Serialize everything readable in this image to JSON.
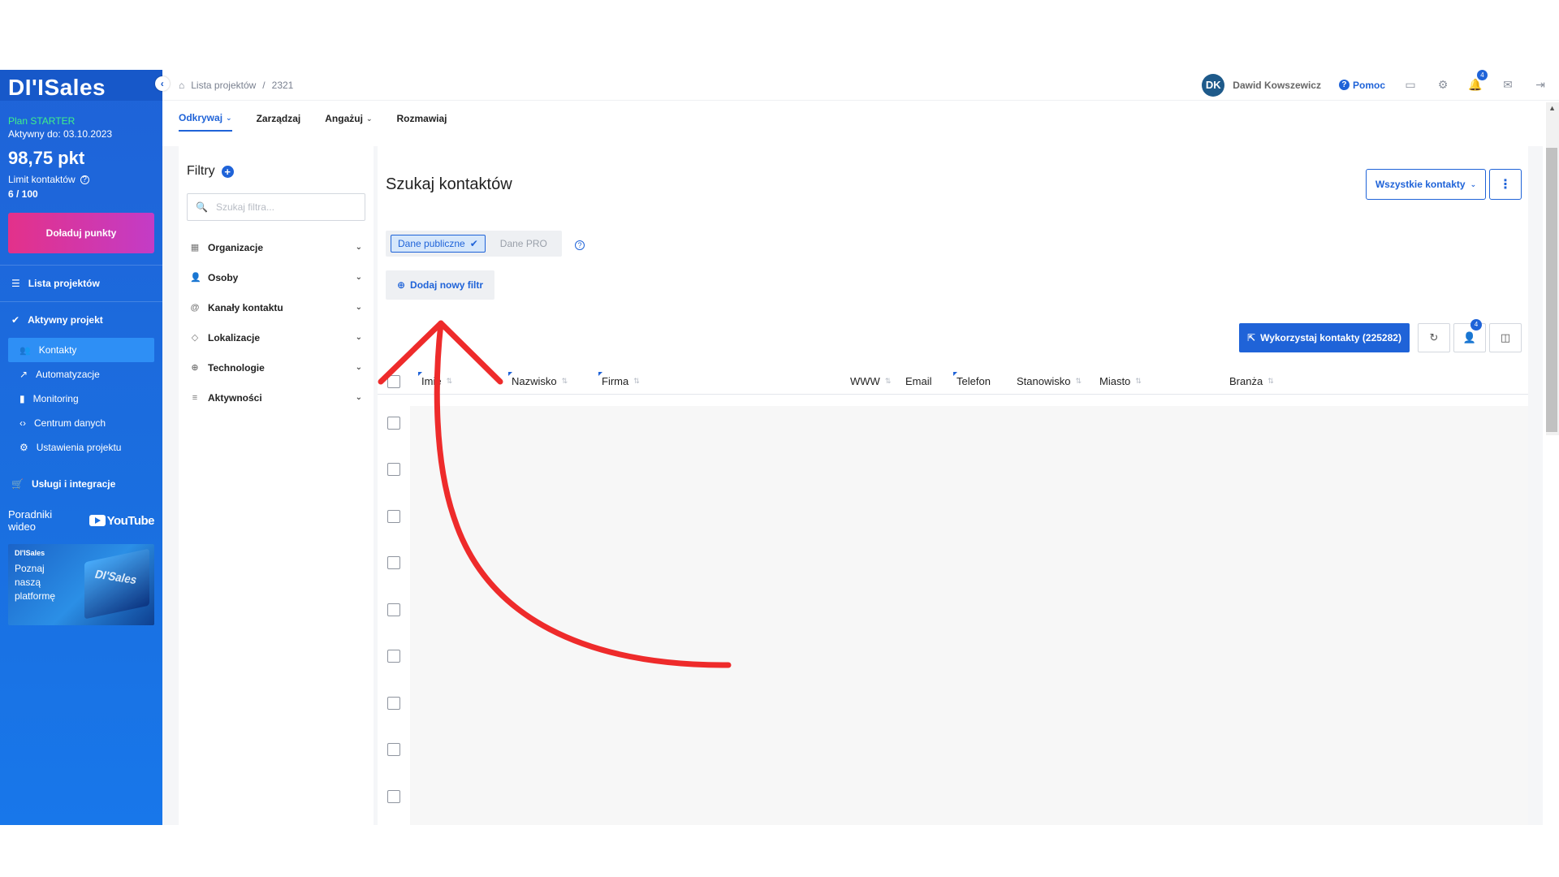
{
  "brand": {
    "logo": "DI'ISales"
  },
  "plan": {
    "name": "Plan STARTER",
    "active_until": "Aktywny do: 03.10.2023",
    "points": "98,75 pkt",
    "limit_label": "Limit kontaktów",
    "limit_value": "6 / 100",
    "topup_button": "Doładuj punkty"
  },
  "sidebar": {
    "projects": "Lista projektów",
    "active_project": "Aktywny projekt",
    "sub_items": [
      {
        "label": "Kontakty",
        "icon": "users-icon",
        "active": true
      },
      {
        "label": "Automatyzacje",
        "icon": "trend-icon",
        "active": false
      },
      {
        "label": "Monitoring",
        "icon": "bar-chart-icon",
        "active": false
      },
      {
        "label": "Centrum danych",
        "icon": "code-icon",
        "active": false
      },
      {
        "label": "Ustawienia projektu",
        "icon": "gear-icon",
        "active": false
      }
    ],
    "services": "Usługi i integracje",
    "video_label": "Poradniki wideo",
    "youtube": "YouTube",
    "promo": {
      "logo": "DI'ISales",
      "text": "Poznaj naszą platformę",
      "art_text": "DI'Sales"
    }
  },
  "breadcrumb": {
    "home": "Lista projektów",
    "sep": "/",
    "current": "2321"
  },
  "topbar": {
    "avatar": "DK",
    "user_name": "Dawid Kowszewicz",
    "help": "Pomoc",
    "notifications_count": "4"
  },
  "tabs": [
    {
      "label": "Odkrywaj",
      "active": true,
      "dropdown": true
    },
    {
      "label": "Zarządzaj",
      "active": false,
      "dropdown": false
    },
    {
      "label": "Angażuj",
      "active": false,
      "dropdown": true
    },
    {
      "label": "Rozmawiaj",
      "active": false,
      "dropdown": false
    }
  ],
  "filters": {
    "title": "Filtry",
    "search_placeholder": "Szukaj filtra...",
    "groups": [
      {
        "label": "Organizacje",
        "icon": "building-icon"
      },
      {
        "label": "Osoby",
        "icon": "person-icon"
      },
      {
        "label": "Kanały kontaktu",
        "icon": "at-icon"
      },
      {
        "label": "Lokalizacje",
        "icon": "location-icon"
      },
      {
        "label": "Technologie",
        "icon": "globe-icon"
      },
      {
        "label": "Aktywności",
        "icon": "database-icon"
      }
    ]
  },
  "main": {
    "title": "Szukaj kontaktów",
    "all_contacts_button": "Wszystkie kontakty",
    "data_tabs": {
      "public": "Dane publiczne",
      "pro": "Dane PRO"
    },
    "add_filter_button": "Dodaj nowy filtr",
    "use_contacts_button": "Wykorzystaj kontakty (225282)",
    "assign_badge": "4"
  },
  "table": {
    "columns": [
      "Imię",
      "Nazwisko",
      "Firma",
      "WWW",
      "Email",
      "Telefon",
      "Stanowisko",
      "Miasto",
      "Branża"
    ]
  },
  "colors": {
    "accent": "#1f63d8",
    "sidebar": "#1a6fe0",
    "cta": "#d6349f",
    "plan": "#3ff08a",
    "annotation": "#ee2b2b"
  }
}
